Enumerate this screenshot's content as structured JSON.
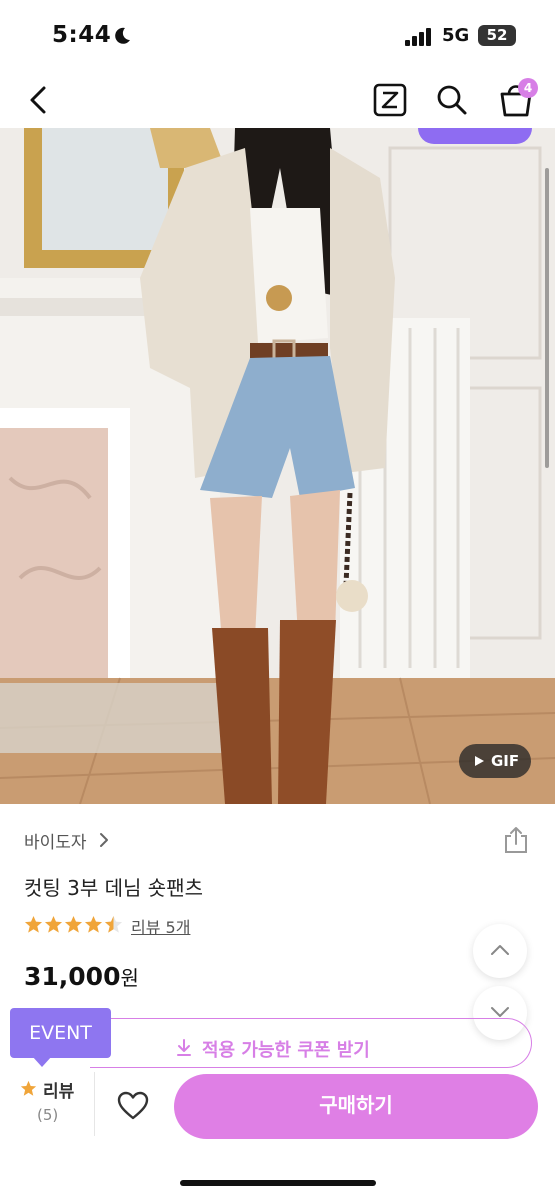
{
  "status_bar": {
    "time": "5:44",
    "network": "5G",
    "battery": "52"
  },
  "header": {
    "cart_badge": "4",
    "icons": [
      "back-arrow-icon",
      "z-box-icon",
      "search-icon",
      "cart-bag-icon"
    ]
  },
  "hero": {
    "gif_label": "GIF"
  },
  "product": {
    "brand": "바이도자",
    "title": "컷팅 3부 데님 숏팬츠",
    "rating": 4.5,
    "review_link": "리뷰 5개",
    "price": "31,000",
    "price_unit": "원"
  },
  "coupon": {
    "label": "적용 가능한 쿠폰 받기",
    "event_tag": "EVENT"
  },
  "bottom_bar": {
    "review_label": "리뷰",
    "review_count": "(5)",
    "buy_label": "구매하기"
  },
  "colors": {
    "accent_pink": "#df7fe5",
    "event_purple": "#8e76f0",
    "star_orange": "#f0a53a"
  }
}
